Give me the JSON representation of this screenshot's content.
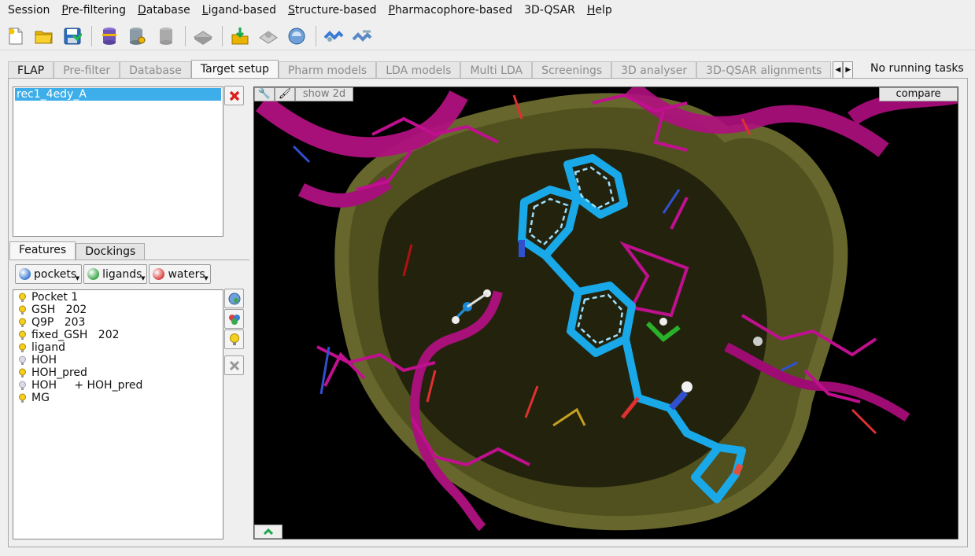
{
  "menu": {
    "items": [
      {
        "label": "Session",
        "u": ""
      },
      {
        "label": "Pre-filtering",
        "u": "P"
      },
      {
        "label": "Database",
        "u": "D"
      },
      {
        "label": "Ligand-based",
        "u": "L"
      },
      {
        "label": "Structure-based",
        "u": "S"
      },
      {
        "label": "Pharmacophore-based",
        "u": "P"
      },
      {
        "label": "3D-QSAR",
        "u": ""
      },
      {
        "label": "Help",
        "u": "H"
      }
    ]
  },
  "toolbar": {
    "icons": [
      "new-session-icon",
      "open-folder-icon",
      "save-icon",
      "database-icon",
      "database-search-icon",
      "database-gray-icon",
      "molecule-gray-icon",
      "import-icon",
      "pharmacophore-icon",
      "pocket-sphere-icon",
      "ligand-blue-icon",
      "ligand-align-icon"
    ]
  },
  "tabs": [
    {
      "label": "FLAP",
      "state": "first"
    },
    {
      "label": "Pre-filter",
      "state": "disabled"
    },
    {
      "label": "Database",
      "state": "disabled"
    },
    {
      "label": "Target setup",
      "state": "active"
    },
    {
      "label": "Pharm models",
      "state": "disabled"
    },
    {
      "label": "LDA models",
      "state": "disabled"
    },
    {
      "label": "Multi LDA",
      "state": "disabled"
    },
    {
      "label": "Screenings",
      "state": "disabled"
    },
    {
      "label": "3D analyser",
      "state": "disabled"
    },
    {
      "label": "3D-QSAR alignments",
      "state": "disabled"
    }
  ],
  "status": {
    "running": "No running tasks"
  },
  "targets": {
    "items": [
      "rec1_4edy_A"
    ]
  },
  "subtabs": [
    {
      "label": "Features",
      "active": true
    },
    {
      "label": "Dockings",
      "active": false
    }
  ],
  "dropdowns": [
    {
      "label": "pockets",
      "color": "#3a7bd5"
    },
    {
      "label": "ligands",
      "color": "#3aa84a"
    },
    {
      "label": "waters",
      "color": "#d94040"
    }
  ],
  "features": [
    {
      "label": "Pocket 1",
      "on": true
    },
    {
      "label": "GSH   202",
      "on": true
    },
    {
      "label": "Q9P   203",
      "on": true
    },
    {
      "label": "fixed_GSH   202",
      "on": true
    },
    {
      "label": "ligand",
      "on": true
    },
    {
      "label": "HOH",
      "on": false
    },
    {
      "label": "HOH_pred",
      "on": true
    },
    {
      "label": "HOH     + HOH_pred",
      "on": false
    },
    {
      "label": "MG",
      "on": true
    }
  ],
  "viewer": {
    "show2d_label": "show 2d",
    "compare_label": "compare"
  },
  "colors": {
    "accent": "#3daee9",
    "protein": "#c0108f",
    "surface": "#8a8a3c",
    "ligand": "#19a9e8"
  }
}
